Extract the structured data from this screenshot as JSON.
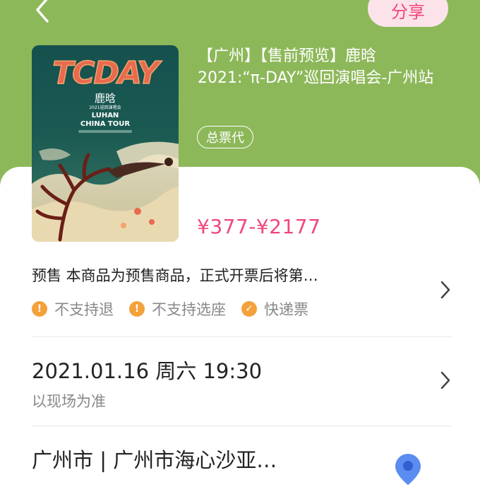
{
  "header": {
    "share_label": "分享",
    "title_line1": "【广州】【售前预览】鹿晗",
    "title_line2": "2021:“π-DAY”巡回演唱会-广州站",
    "agent_label": "总票代"
  },
  "poster": {
    "logo_text": "TCDAY",
    "artist": "鹿晗",
    "subtitle_small": "2021巡回演唱会",
    "tour_line1": "LUHAN",
    "tour_line2": "CHINA TOUR"
  },
  "price": "¥377-¥2177",
  "presale": {
    "text": "预售  本商品为预售商品，正式开票后将第…",
    "tags": [
      {
        "icon": "exclamation-icon",
        "label": "不支持退"
      },
      {
        "icon": "exclamation-icon",
        "label": "不支持选座"
      },
      {
        "icon": "check-icon",
        "label": "快递票"
      }
    ]
  },
  "datetime": {
    "text": "2021.01.16 周六 19:30",
    "note": "以现场为准"
  },
  "venue": {
    "text": "广州市 | 广州市海心沙亚…"
  },
  "colors": {
    "header_green": "#8db85a",
    "accent_pink": "#f2467a",
    "tag_orange": "#f5a13b",
    "pin_blue": "#5b8cf0"
  }
}
